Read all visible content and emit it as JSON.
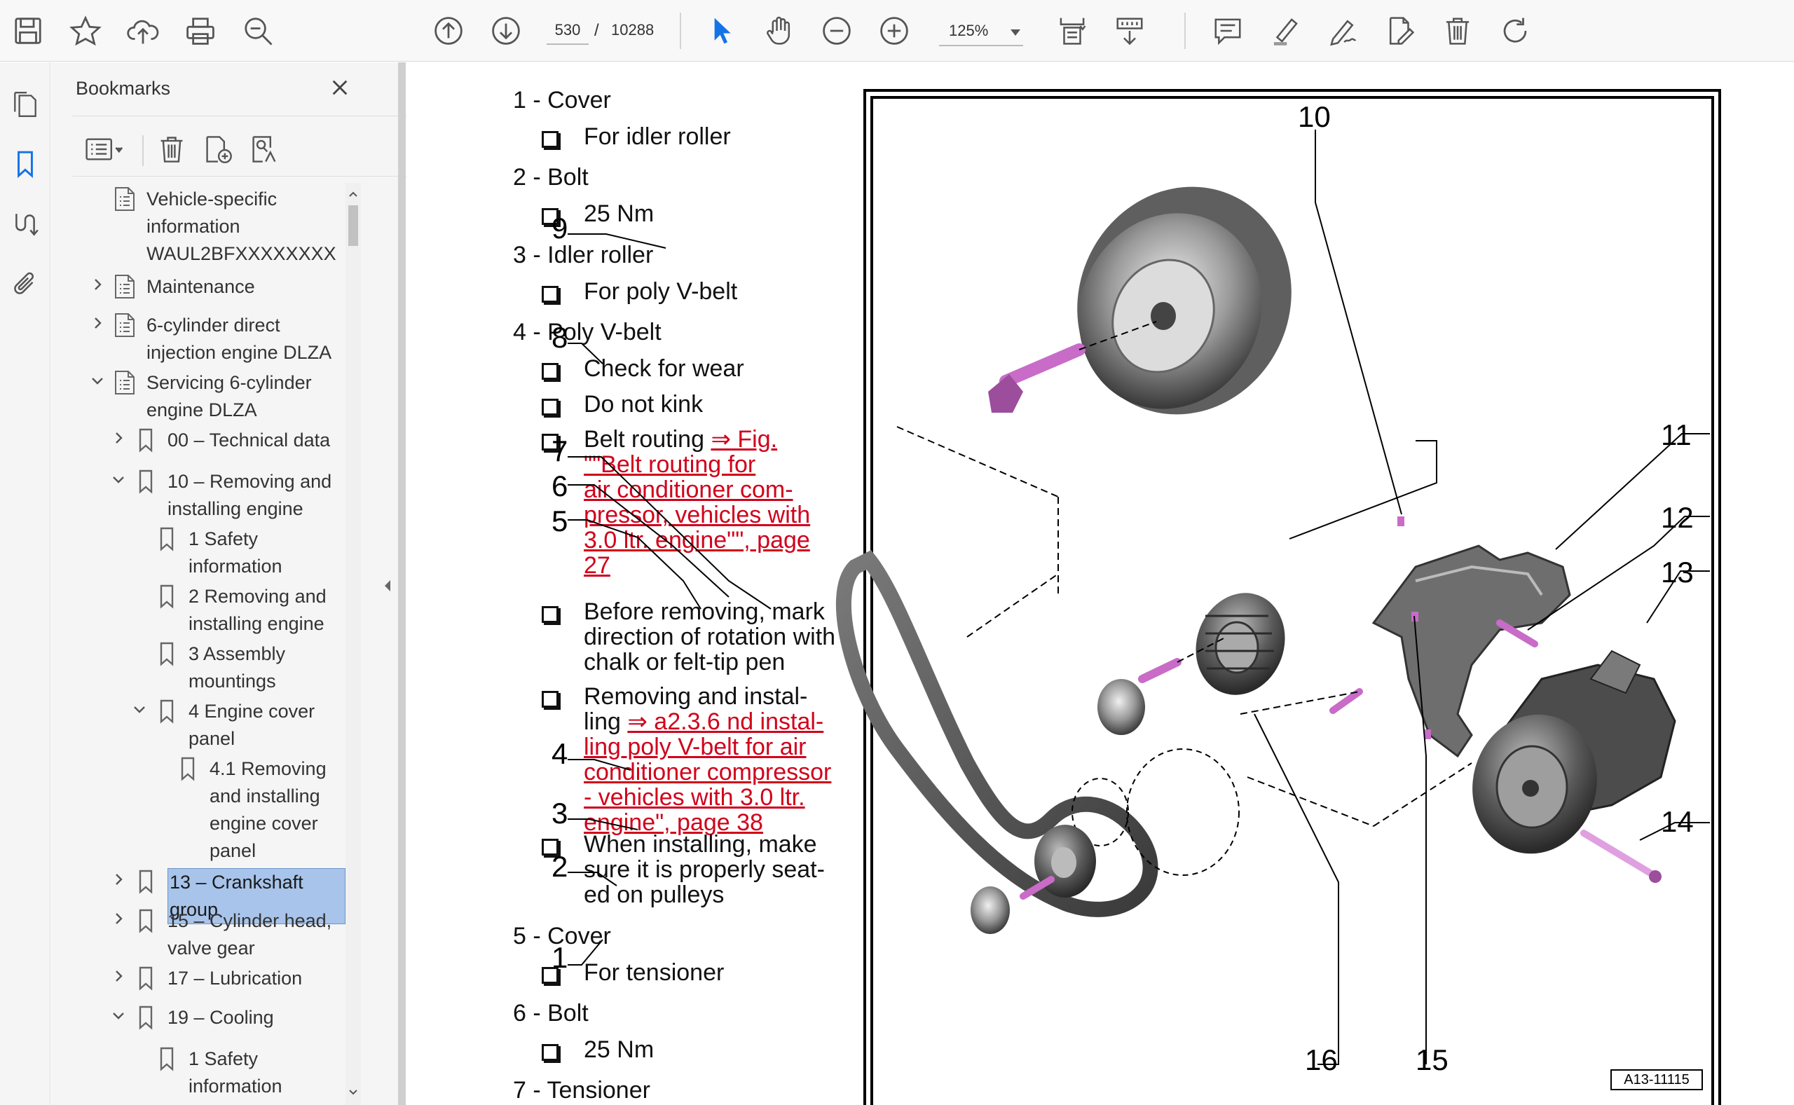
{
  "toolbar": {
    "current_page": "530",
    "page_separator": "/",
    "total_pages": "10288",
    "zoom": "125%"
  },
  "panel": {
    "title": "Bookmarks",
    "close_symbol": "✕"
  },
  "bookmarks": [
    {
      "label": "Vehicle-specific\ninformation\nWAUL2BFXXXXXXXX",
      "chevron": ""
    },
    {
      "label": "Maintenance",
      "chevron": "right"
    },
    {
      "label": "6-cylinder direct\ninjection engine DLZA",
      "chevron": "right"
    },
    {
      "label": "Servicing 6-cylinder\nengine DLZA",
      "chevron": "down"
    },
    {
      "label": "00 – Technical data",
      "chevron": "right"
    },
    {
      "label": "10 – Removing and\ninstalling engine",
      "chevron": "down"
    },
    {
      "label": "1 Safety\ninformation",
      "chevron": ""
    },
    {
      "label": "2 Removing and\ninstalling engine",
      "chevron": ""
    },
    {
      "label": "3 Assembly\nmountings",
      "chevron": ""
    },
    {
      "label": "4 Engine cover\npanel",
      "chevron": "down"
    },
    {
      "label": "4.1 Removing\nand installing\nengine cover\npanel",
      "chevron": ""
    },
    {
      "label": "13 – Crankshaft group",
      "chevron": "right"
    },
    {
      "label": "15 – Cylinder head,\nvalve gear",
      "chevron": "right"
    },
    {
      "label": "17 – Lubrication",
      "chevron": "right"
    },
    {
      "label": "19 – Cooling",
      "chevron": "down"
    },
    {
      "label": "1 Safety\ninformation",
      "chevron": ""
    }
  ],
  "document": {
    "items": [
      {
        "title": "1 - Cover",
        "bullets": [
          {
            "text": "For idler roller"
          }
        ]
      },
      {
        "title": "2 - Bolt",
        "bullets": [
          {
            "text": "25 Nm"
          }
        ]
      },
      {
        "title": "3 - Idler roller",
        "bullets": [
          {
            "text": "For poly V-belt"
          }
        ]
      },
      {
        "title": "4 - Poly V-belt",
        "bullets": [
          {
            "text": "Check for wear"
          },
          {
            "text": "Do not kink"
          },
          {
            "text": "Belt routing ",
            "link": "⇒ Fig.\n\"\"Belt routing for\nair conditioner com-\npressor, vehicles with\n3.0 ltr. engine\"\", page\n27"
          },
          {
            "text": "Before removing, mark\ndirection of rotation with\nchalk or felt-tip pen"
          },
          {
            "text": "Removing and instal-\nling ",
            "link": "⇒ a2.3.6 nd instal-\nling poly V-belt for air\nconditioner compressor\n- vehicles with 3.0 ltr.\nengine\", page 38"
          },
          {
            "text": "When installing, make\nsure it is properly seat-\ned on pulleys"
          }
        ]
      },
      {
        "title": "5 - Cover",
        "bullets": [
          {
            "text": "For tensioner"
          }
        ]
      },
      {
        "title": "6 - Bolt",
        "bullets": [
          {
            "text": "25 Nm"
          }
        ]
      },
      {
        "title": "7 - Tensioner",
        "bullets": []
      }
    ],
    "figure": {
      "callouts": [
        "1",
        "2",
        "3",
        "4",
        "5",
        "6",
        "7",
        "8",
        "9",
        "10",
        "11",
        "12",
        "13",
        "14",
        "15",
        "16"
      ],
      "id": "A13-11115"
    }
  }
}
